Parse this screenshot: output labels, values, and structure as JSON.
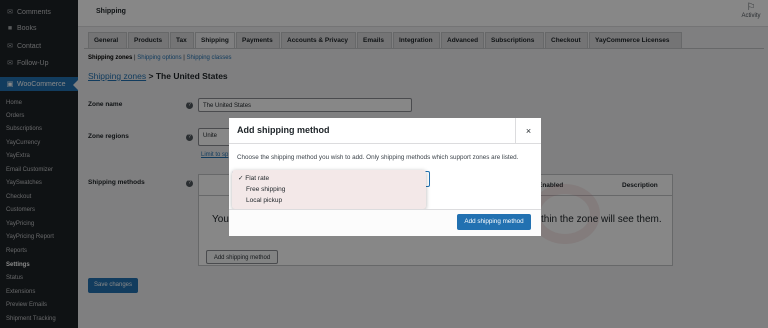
{
  "sidebar": {
    "items": [
      {
        "icon": "comment-icon",
        "glyph": "✉",
        "label": "Comments"
      },
      {
        "icon": "book-icon",
        "glyph": "■",
        "label": "Books"
      },
      {
        "icon": "contact-icon",
        "glyph": "✉",
        "label": "Contact"
      },
      {
        "icon": "follow-up-icon",
        "glyph": "✉",
        "label": "Follow-Up"
      }
    ],
    "woo_label": "WooCommerce",
    "sub_items": [
      "Home",
      "Orders",
      "Subscriptions",
      "YayCurrency",
      "YayExtra",
      "Email Customizer",
      "YaySwatches",
      "Checkout",
      "Customers",
      "YayPricing",
      "YayPricing Report",
      "Reports",
      "Settings",
      "Status",
      "Extensions",
      "Preview Emails",
      "Shipment Tracking"
    ]
  },
  "header": {
    "title": "Shipping",
    "activity_label": "Activity"
  },
  "tabs": [
    "General",
    "Products",
    "Tax",
    "Shipping",
    "Payments",
    "Accounts & Privacy",
    "Emails",
    "Integration",
    "Advanced",
    "Subscriptions",
    "Checkout",
    "YayCommerce Licenses"
  ],
  "active_tab": "Shipping",
  "subnav": {
    "current": "Shipping zones",
    "options": "Shipping options",
    "classes": "Shipping classes",
    "sep": "|"
  },
  "breadcrumb": {
    "link": "Shipping zones",
    "sep": ">",
    "current": "The United States"
  },
  "form": {
    "zone_name_label": "Zone name",
    "zone_name_value": "The United States",
    "zone_regions_label": "Zone regions",
    "zone_regions_value": "Unite",
    "limit_link": "Limit to sp",
    "shipping_methods_label": "Shipping methods",
    "col_enabled": "Enabled",
    "col_description": "Description",
    "empty_start": "You",
    "empty_end": "thin the zone will see them.",
    "add_method_label": "Add shipping method",
    "save_label": "Save changes"
  },
  "modal": {
    "title": "Add shipping method",
    "close": "×",
    "description": "Choose the shipping method you wish to add. Only shipping methods which support zones are listed.",
    "options": [
      "Flat rate",
      "Free shipping",
      "Local pickup"
    ],
    "selected_mark": "✓",
    "add_button": "Add shipping method"
  },
  "colors": {
    "accent": "#2271b1",
    "sidebar": "#1d2327",
    "dropdown_bg": "#f3e8e8"
  }
}
